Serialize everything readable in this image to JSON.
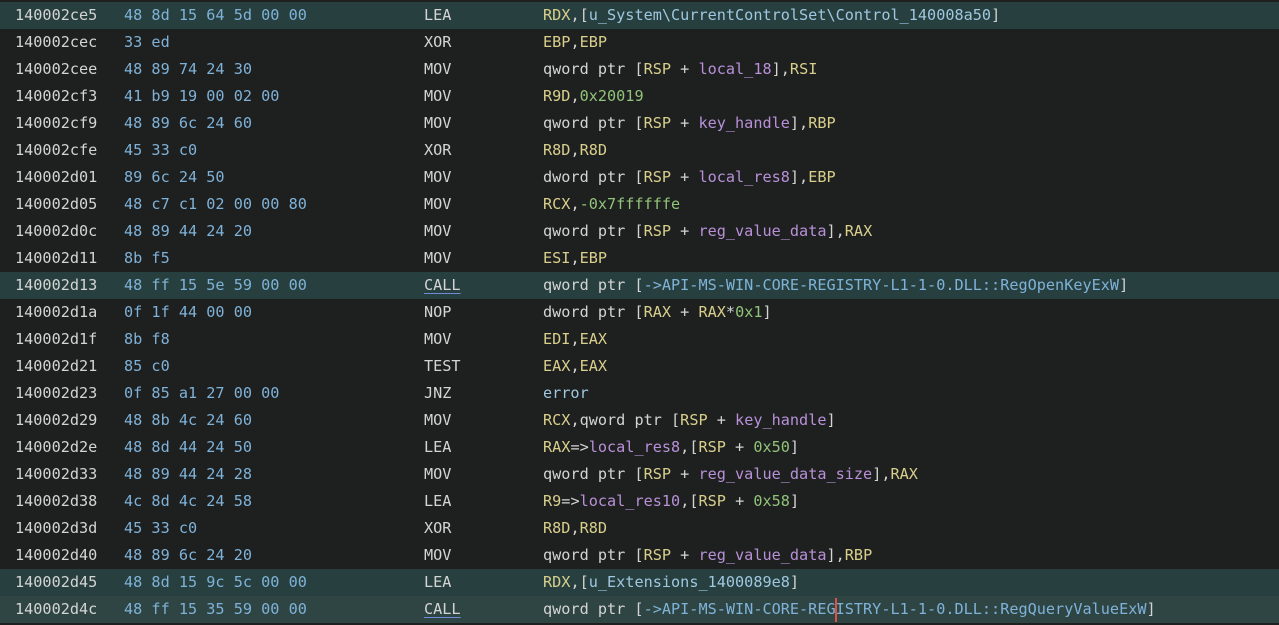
{
  "colors": {
    "background": "#1e1f1f",
    "highlight_row": "#27403f",
    "current_row": "#2f4544",
    "address": "#d4d4d4",
    "bytes": "#7fb2d8",
    "register": "#d8cf8c",
    "variable": "#b891d8",
    "number": "#91c47a",
    "external": "#7fb2d8",
    "cursor": "#e05040"
  },
  "listing": [
    {
      "addr": "140002ce5",
      "bytes": "48 8d 15 64 5d 00 00",
      "mnem": "LEA",
      "style": "hl",
      "ops": [
        [
          "reg",
          "RDX"
        ],
        [
          "pun",
          ",["
        ],
        [
          "lbl",
          "u_System\\CurrentControlSet\\Control_140008a50"
        ],
        [
          "pun",
          "]"
        ]
      ]
    },
    {
      "addr": "140002cec",
      "bytes": "33 ed",
      "mnem": "XOR",
      "ops": [
        [
          "reg",
          "EBP"
        ],
        [
          "pun",
          ","
        ],
        [
          "reg",
          "EBP"
        ]
      ]
    },
    {
      "addr": "140002cee",
      "bytes": "48 89 74 24 30",
      "mnem": "MOV",
      "ops": [
        [
          "text",
          "qword ptr ["
        ],
        [
          "reg",
          "RSP"
        ],
        [
          "text",
          " + "
        ],
        [
          "var",
          "local_18"
        ],
        [
          "text",
          "],"
        ],
        [
          "reg",
          "RSI"
        ]
      ]
    },
    {
      "addr": "140002cf3",
      "bytes": "41 b9 19 00 02 00",
      "mnem": "MOV",
      "ops": [
        [
          "reg",
          "R9D"
        ],
        [
          "pun",
          ","
        ],
        [
          "num",
          "0x20019"
        ]
      ]
    },
    {
      "addr": "140002cf9",
      "bytes": "48 89 6c 24 60",
      "mnem": "MOV",
      "ops": [
        [
          "text",
          "qword ptr ["
        ],
        [
          "reg",
          "RSP"
        ],
        [
          "text",
          " + "
        ],
        [
          "var",
          "key_handle"
        ],
        [
          "text",
          "],"
        ],
        [
          "reg",
          "RBP"
        ]
      ]
    },
    {
      "addr": "140002cfe",
      "bytes": "45 33 c0",
      "mnem": "XOR",
      "ops": [
        [
          "reg",
          "R8D"
        ],
        [
          "pun",
          ","
        ],
        [
          "reg",
          "R8D"
        ]
      ]
    },
    {
      "addr": "140002d01",
      "bytes": "89 6c 24 50",
      "mnem": "MOV",
      "ops": [
        [
          "text",
          "dword ptr ["
        ],
        [
          "reg",
          "RSP"
        ],
        [
          "text",
          " + "
        ],
        [
          "var",
          "local_res8"
        ],
        [
          "text",
          "],"
        ],
        [
          "reg",
          "EBP"
        ]
      ]
    },
    {
      "addr": "140002d05",
      "bytes": "48 c7 c1 02 00 00 80",
      "mnem": "MOV",
      "ops": [
        [
          "reg",
          "RCX"
        ],
        [
          "pun",
          ","
        ],
        [
          "num",
          "-0x7ffffffe"
        ]
      ]
    },
    {
      "addr": "140002d0c",
      "bytes": "48 89 44 24 20",
      "mnem": "MOV",
      "ops": [
        [
          "text",
          "qword ptr ["
        ],
        [
          "reg",
          "RSP"
        ],
        [
          "text",
          " + "
        ],
        [
          "var",
          "reg_value_data"
        ],
        [
          "text",
          "],"
        ],
        [
          "reg",
          "RAX"
        ]
      ]
    },
    {
      "addr": "140002d11",
      "bytes": "8b f5",
      "mnem": "MOV",
      "ops": [
        [
          "reg",
          "ESI"
        ],
        [
          "pun",
          ","
        ],
        [
          "reg",
          "EBP"
        ]
      ]
    },
    {
      "addr": "140002d13",
      "bytes": "48 ff 15 5e 59 00 00",
      "mnem": "CALL",
      "style": "hl",
      "call": true,
      "ops": [
        [
          "text",
          "qword ptr ["
        ],
        [
          "ext",
          "->API-MS-WIN-CORE-REGISTRY-L1-1-0.DLL::RegOpenKeyExW"
        ],
        [
          "text",
          "]"
        ]
      ]
    },
    {
      "addr": "140002d1a",
      "bytes": "0f 1f 44 00 00",
      "mnem": "NOP",
      "ops": [
        [
          "text",
          "dword ptr ["
        ],
        [
          "reg",
          "RAX"
        ],
        [
          "text",
          " + "
        ],
        [
          "reg",
          "RAX"
        ],
        [
          "text",
          "*"
        ],
        [
          "num",
          "0x1"
        ],
        [
          "text",
          "]"
        ]
      ]
    },
    {
      "addr": "140002d1f",
      "bytes": "8b f8",
      "mnem": "MOV",
      "ops": [
        [
          "reg",
          "EDI"
        ],
        [
          "pun",
          ","
        ],
        [
          "reg",
          "EAX"
        ]
      ]
    },
    {
      "addr": "140002d21",
      "bytes": "85 c0",
      "mnem": "TEST",
      "ops": [
        [
          "reg",
          "EAX"
        ],
        [
          "pun",
          ","
        ],
        [
          "reg",
          "EAX"
        ]
      ]
    },
    {
      "addr": "140002d23",
      "bytes": "0f 85 a1 27 00 00",
      "mnem": "JNZ",
      "ops": [
        [
          "lbl",
          "error"
        ]
      ]
    },
    {
      "addr": "140002d29",
      "bytes": "48 8b 4c 24 60",
      "mnem": "MOV",
      "ops": [
        [
          "reg",
          "RCX"
        ],
        [
          "text",
          ",qword ptr ["
        ],
        [
          "reg",
          "RSP"
        ],
        [
          "text",
          " + "
        ],
        [
          "var",
          "key_handle"
        ],
        [
          "text",
          "]"
        ]
      ]
    },
    {
      "addr": "140002d2e",
      "bytes": "48 8d 44 24 50",
      "mnem": "LEA",
      "ops": [
        [
          "reg",
          "RAX"
        ],
        [
          "text",
          "=>"
        ],
        [
          "var",
          "local_res8"
        ],
        [
          "text",
          ",["
        ],
        [
          "reg",
          "RSP"
        ],
        [
          "text",
          " + "
        ],
        [
          "num",
          "0x50"
        ],
        [
          "text",
          "]"
        ]
      ]
    },
    {
      "addr": "140002d33",
      "bytes": "48 89 44 24 28",
      "mnem": "MOV",
      "ops": [
        [
          "text",
          "qword ptr ["
        ],
        [
          "reg",
          "RSP"
        ],
        [
          "text",
          " + "
        ],
        [
          "var",
          "reg_value_data_size"
        ],
        [
          "text",
          "],"
        ],
        [
          "reg",
          "RAX"
        ]
      ]
    },
    {
      "addr": "140002d38",
      "bytes": "4c 8d 4c 24 58",
      "mnem": "LEA",
      "ops": [
        [
          "reg",
          "R9"
        ],
        [
          "text",
          "=>"
        ],
        [
          "var",
          "local_res10"
        ],
        [
          "text",
          ",["
        ],
        [
          "reg",
          "RSP"
        ],
        [
          "text",
          " + "
        ],
        [
          "num",
          "0x58"
        ],
        [
          "text",
          "]"
        ]
      ]
    },
    {
      "addr": "140002d3d",
      "bytes": "45 33 c0",
      "mnem": "XOR",
      "ops": [
        [
          "reg",
          "R8D"
        ],
        [
          "pun",
          ","
        ],
        [
          "reg",
          "R8D"
        ]
      ]
    },
    {
      "addr": "140002d40",
      "bytes": "48 89 6c 24 20",
      "mnem": "MOV",
      "ops": [
        [
          "text",
          "qword ptr ["
        ],
        [
          "reg",
          "RSP"
        ],
        [
          "text",
          " + "
        ],
        [
          "var",
          "reg_value_data"
        ],
        [
          "text",
          "],"
        ],
        [
          "reg",
          "RBP"
        ]
      ]
    },
    {
      "addr": "140002d45",
      "bytes": "48 8d 15 9c 5c 00 00",
      "mnem": "LEA",
      "style": "hl",
      "ops": [
        [
          "reg",
          "RDX"
        ],
        [
          "pun",
          ",["
        ],
        [
          "lbl",
          "u_Extensions_1400089e8"
        ],
        [
          "pun",
          "]"
        ]
      ]
    },
    {
      "addr": "140002d4c",
      "bytes": "48 ff 15 35 59 00 00",
      "mnem": "CALL",
      "style": "cur",
      "call": true,
      "ops": [
        [
          "text",
          "qword ptr ["
        ],
        [
          "ext",
          "->API-MS-WIN-CORE-REGISTRY-L1-1-0.DLL::RegQueryValueExW"
        ],
        [
          "text",
          "]"
        ]
      ]
    }
  ]
}
